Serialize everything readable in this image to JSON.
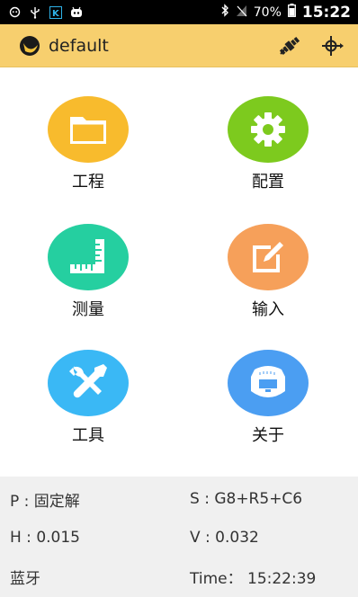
{
  "status_bar": {
    "icons": [
      "android-debug-icon",
      "usb-icon",
      "app-k-icon",
      "bot-icon",
      "bluetooth-icon",
      "no-sim-icon"
    ],
    "battery": "70%",
    "time": "15:22"
  },
  "app_bar": {
    "title": "default",
    "actions": [
      "satellite-icon",
      "target-crosshair-icon"
    ],
    "colors": {
      "background": "#f7cf6e"
    }
  },
  "menu": [
    {
      "label": "工程",
      "icon": "folder-icon",
      "color": "#f8bb2d"
    },
    {
      "label": "配置",
      "icon": "gear-icon",
      "color": "#7dca1e"
    },
    {
      "label": "测量",
      "icon": "ruler-icon",
      "color": "#25cfa0"
    },
    {
      "label": "输入",
      "icon": "edit-icon",
      "color": "#f6a05a"
    },
    {
      "label": "工具",
      "icon": "tools-icon",
      "color": "#3ab8f5"
    },
    {
      "label": "关于",
      "icon": "receiver-icon",
      "color": "#4b9ef2"
    }
  ],
  "info": {
    "p": "P : 固定解",
    "s": "S : G8+R5+C6",
    "h": "H : 0.015",
    "v": "V : 0.032",
    "conn": "蓝牙",
    "time": "Time： 15:22:39"
  }
}
